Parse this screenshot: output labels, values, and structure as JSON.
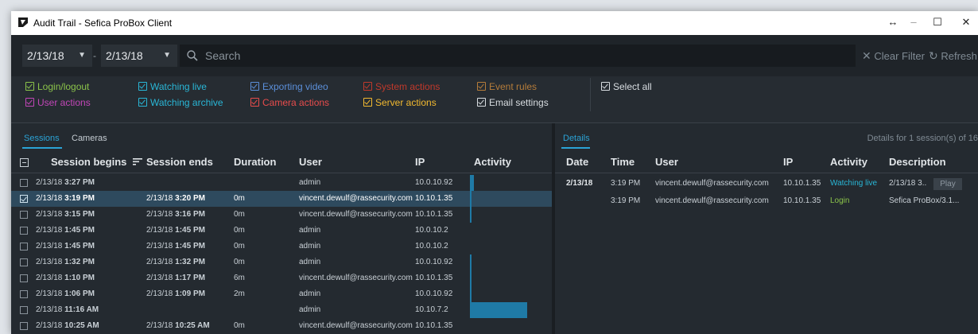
{
  "window": {
    "title": "Audit Trail - Sefica ProBox Client",
    "controls": {
      "restore": "↔",
      "minimize": "–",
      "maximize": "☐",
      "close": "✕"
    }
  },
  "toolbar": {
    "date_from": "2/13/18",
    "date_to": "2/13/18",
    "dash": "-",
    "search_placeholder": "Search",
    "clear_filter": "Clear Filter",
    "refresh": "Refresh"
  },
  "filters": {
    "items": [
      {
        "label": "Login/logout",
        "color": "#8bc34a",
        "checked": true
      },
      {
        "label": "User actions",
        "color": "#c246b8",
        "checked": true
      },
      {
        "label": "Watching live",
        "color": "#29b6d6",
        "checked": true
      },
      {
        "label": "Watching archive",
        "color": "#29b6d6",
        "checked": true
      },
      {
        "label": "Exporting video",
        "color": "#5b8fd9",
        "checked": true
      },
      {
        "label": "Camera actions",
        "color": "#e84c4c",
        "checked": true
      },
      {
        "label": "System actions",
        "color": "#c0392b",
        "checked": true
      },
      {
        "label": "Server actions",
        "color": "#f2b930",
        "checked": true
      },
      {
        "label": "Event rules",
        "color": "#b57c3a",
        "checked": true
      },
      {
        "label": "Email settings",
        "color": "#d8dde1",
        "checked": true
      },
      {
        "label": "Select all",
        "color": "#d8dde1",
        "checked": true
      }
    ]
  },
  "sessions_panel": {
    "tabs": [
      "Sessions",
      "Cameras"
    ],
    "columns": [
      "Session begins",
      "Session ends",
      "Duration",
      "User",
      "IP",
      "Activity"
    ],
    "rows": [
      {
        "begin_date": "2/13/18",
        "begin_time": "3:27 PM",
        "end_date": "",
        "end_time": "",
        "duration": "",
        "user": "admin",
        "ip": "10.0.10.92",
        "activity": 0.07,
        "selected": false
      },
      {
        "begin_date": "2/13/18",
        "begin_time": "3:19 PM",
        "end_date": "2/13/18",
        "end_time": "3:20 PM",
        "duration": "0m",
        "user": "vincent.dewulf@rassecurity.com",
        "ip": "10.10.1.35",
        "activity": 0.03,
        "selected": true
      },
      {
        "begin_date": "2/13/18",
        "begin_time": "3:15 PM",
        "end_date": "2/13/18",
        "end_time": "3:16 PM",
        "duration": "0m",
        "user": "vincent.dewulf@rassecurity.com",
        "ip": "10.10.1.35",
        "activity": 0.03,
        "selected": false
      },
      {
        "begin_date": "2/13/18",
        "begin_time": "1:45 PM",
        "end_date": "2/13/18",
        "end_time": "1:45 PM",
        "duration": "0m",
        "user": "admin",
        "ip": "10.0.10.2",
        "activity": 0,
        "selected": false
      },
      {
        "begin_date": "2/13/18",
        "begin_time": "1:45 PM",
        "end_date": "2/13/18",
        "end_time": "1:45 PM",
        "duration": "0m",
        "user": "admin",
        "ip": "10.0.10.2",
        "activity": 0,
        "selected": false
      },
      {
        "begin_date": "2/13/18",
        "begin_time": "1:32 PM",
        "end_date": "2/13/18",
        "end_time": "1:32 PM",
        "duration": "0m",
        "user": "admin",
        "ip": "10.0.10.92",
        "activity": 0.03,
        "selected": false
      },
      {
        "begin_date": "2/13/18",
        "begin_time": "1:10 PM",
        "end_date": "2/13/18",
        "end_time": "1:17 PM",
        "duration": "6m",
        "user": "vincent.dewulf@rassecurity.com",
        "ip": "10.10.1.35",
        "activity": 0.03,
        "selected": false
      },
      {
        "begin_date": "2/13/18",
        "begin_time": "1:06 PM",
        "end_date": "2/13/18",
        "end_time": "1:09 PM",
        "duration": "2m",
        "user": "admin",
        "ip": "10.0.10.92",
        "activity": 0.03,
        "selected": false
      },
      {
        "begin_date": "2/13/18",
        "begin_time": "11:16 AM",
        "end_date": "",
        "end_time": "",
        "duration": "",
        "user": "admin",
        "ip": "10.10.7.2",
        "activity": 1.0,
        "selected": false
      },
      {
        "begin_date": "2/13/18",
        "begin_time": "10:25 AM",
        "end_date": "2/13/18",
        "end_time": "10:25 AM",
        "duration": "0m",
        "user": "vincent.dewulf@rassecurity.com",
        "ip": "10.10.1.35",
        "activity": 0,
        "selected": false
      }
    ]
  },
  "details_panel": {
    "tab": "Details",
    "summary": "Details for 1 session(s) of 16",
    "columns": [
      "Date",
      "Time",
      "User",
      "IP",
      "Activity",
      "Description"
    ],
    "rows": [
      {
        "date": "2/13/18",
        "time": "3:19 PM",
        "user": "vincent.dewulf@rassecurity.com",
        "ip": "10.10.1.35",
        "activity": "Watching live",
        "activity_color": "#29b6d6",
        "description": "2/13/18 3..",
        "play": "Play"
      },
      {
        "date": "",
        "time": "3:19 PM",
        "user": "vincent.dewulf@rassecurity.com",
        "ip": "10.10.1.35",
        "activity": "Login",
        "activity_color": "#8bc34a",
        "description": "Sefica ProBox/3.1...",
        "play": ""
      }
    ]
  }
}
